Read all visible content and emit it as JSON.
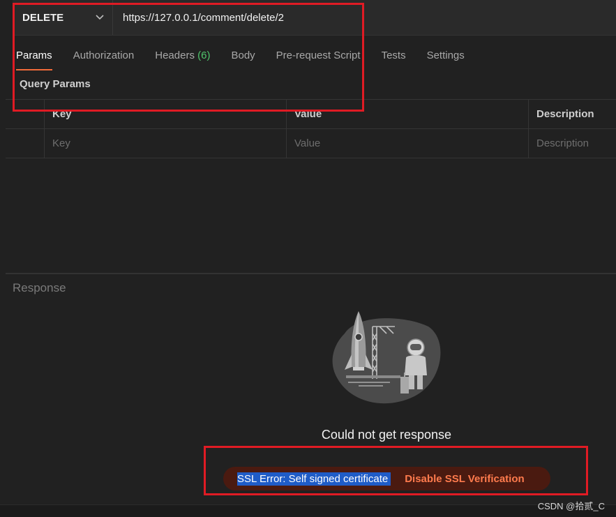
{
  "request": {
    "method": "DELETE",
    "method_chevron_icon": "chevron-down-icon",
    "url": "https://127.0.0.1/comment/delete/2"
  },
  "tabs": [
    {
      "label": "Params",
      "active": true
    },
    {
      "label": "Authorization"
    },
    {
      "label": "Headers",
      "count": "(6)"
    },
    {
      "label": "Body"
    },
    {
      "label": "Pre-request Script"
    },
    {
      "label": "Tests"
    },
    {
      "label": "Settings"
    }
  ],
  "query_params": {
    "title": "Query Params",
    "headers": {
      "key": "Key",
      "value": "Value",
      "description": "Description"
    },
    "placeholders": {
      "key": "Key",
      "value": "Value",
      "description": "Description"
    }
  },
  "response": {
    "label": "Response",
    "illustration_icon": "rocket-astronaut-illustration",
    "message": "Could not get response",
    "error_text": "SSL Error: Self signed certificate",
    "action_label": "Disable SSL Verification"
  },
  "watermark": "CSDN @拾贰_C",
  "colors": {
    "background": "#212121",
    "active_tab_underline": "#f26b3a",
    "headers_count": "#4fc36b",
    "error_pill": "#4a1a10",
    "error_action": "#ff7b4d",
    "text_selection": "#1f5cc7",
    "annotation_box": "#e01b24"
  }
}
